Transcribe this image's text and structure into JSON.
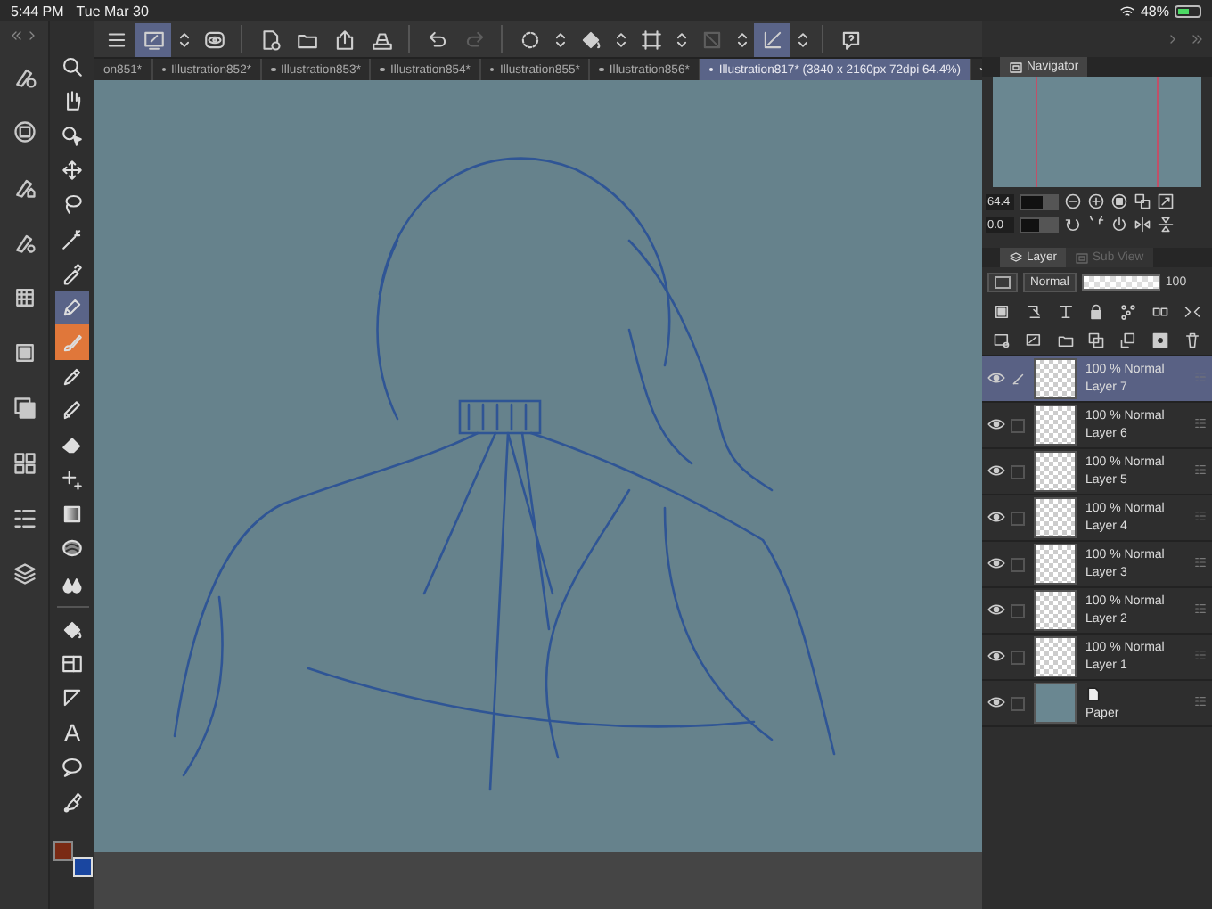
{
  "status_bar": {
    "time": "5:44 PM",
    "date": "Tue Mar 30",
    "battery": "48%"
  },
  "toolbar": {
    "items": [
      {
        "kind": "menu",
        "selected": false,
        "disabled": false
      },
      {
        "kind": "monitor",
        "selected": true,
        "disabled": false
      },
      {
        "kind": "stepper",
        "selected": false,
        "disabled": false
      },
      {
        "kind": "eye-badge",
        "selected": false,
        "disabled": false,
        "group_end": true
      },
      {
        "kind": "new-page",
        "selected": false,
        "disabled": false
      },
      {
        "kind": "folder",
        "selected": false,
        "disabled": false
      },
      {
        "kind": "share",
        "selected": false,
        "disabled": false
      },
      {
        "kind": "tray",
        "selected": false,
        "disabled": false,
        "group_end": true
      },
      {
        "kind": "undo",
        "selected": false,
        "disabled": false
      },
      {
        "kind": "redo",
        "selected": false,
        "disabled": true,
        "group_end": true
      },
      {
        "kind": "dotted-circle",
        "selected": false,
        "disabled": false
      },
      {
        "kind": "stepper",
        "selected": false,
        "disabled": false
      },
      {
        "kind": "fill-bucket",
        "selected": false,
        "disabled": false
      },
      {
        "kind": "stepper",
        "selected": false,
        "disabled": false
      },
      {
        "kind": "selection-frame",
        "selected": false,
        "disabled": false
      },
      {
        "kind": "stepper",
        "selected": false,
        "disabled": false
      },
      {
        "kind": "slash-square",
        "selected": false,
        "disabled": true
      },
      {
        "kind": "stepper",
        "selected": false,
        "disabled": false
      },
      {
        "kind": "ruler-check",
        "selected": true,
        "disabled": false
      },
      {
        "kind": "stepper",
        "selected": false,
        "disabled": false,
        "group_end": true
      },
      {
        "kind": "help",
        "selected": false,
        "disabled": false
      }
    ]
  },
  "tabs": [
    {
      "label": "on851*",
      "selected": false
    },
    {
      "label": "Illustration852*",
      "selected": false
    },
    {
      "label": "Illustration853*",
      "selected": false
    },
    {
      "label": "Illustration854*",
      "selected": false
    },
    {
      "label": "Illustration855*",
      "selected": false
    },
    {
      "label": "Illustration856*",
      "selected": false
    },
    {
      "label": "Illustration817* (3840 x 2160px 72dpi 64.4%)",
      "selected": true
    }
  ],
  "command_bar": {
    "items": [
      {
        "kind": "pen-circle"
      },
      {
        "kind": "circle-square"
      },
      {
        "kind": "pen-house"
      },
      {
        "kind": "pen-gear"
      },
      {
        "kind": "grid"
      },
      {
        "kind": "square"
      },
      {
        "kind": "stacked-square"
      },
      {
        "kind": "four-squares"
      },
      {
        "kind": "list"
      },
      {
        "kind": "stack"
      }
    ]
  },
  "tools": {
    "items": [
      {
        "kind": "search",
        "selected": false
      },
      {
        "kind": "hand",
        "selected": false
      },
      {
        "kind": "cursor",
        "selected": false
      },
      {
        "kind": "move",
        "selected": false
      },
      {
        "kind": "lasso",
        "selected": false
      },
      {
        "kind": "wand",
        "selected": false
      },
      {
        "kind": "eyedropper",
        "selected": false
      },
      {
        "kind": "pen",
        "selected": true
      },
      {
        "kind": "brush",
        "selected": false,
        "color": "#e0773a"
      },
      {
        "kind": "pencil",
        "selected": false
      },
      {
        "kind": "marker",
        "selected": false
      },
      {
        "kind": "eraser",
        "selected": false
      },
      {
        "kind": "sparkle",
        "selected": false
      },
      {
        "kind": "gradient",
        "selected": false
      },
      {
        "kind": "blob",
        "selected": false
      },
      {
        "kind": "drops",
        "selected": false
      },
      {
        "kind": "fill-bucket",
        "selected": false
      },
      {
        "kind": "frame",
        "selected": false
      },
      {
        "kind": "triangle",
        "selected": false
      },
      {
        "kind": "text",
        "selected": false,
        "glyph": "A"
      },
      {
        "kind": "speech-bubble",
        "selected": false
      },
      {
        "kind": "correction",
        "selected": false
      }
    ],
    "swatches": [
      {
        "kind": "main",
        "color": "#7a2a14"
      },
      {
        "kind": "sub",
        "color": "#1a46a0"
      }
    ]
  },
  "navigator": {
    "title": "Navigator",
    "zoom": "64.4",
    "zoom_slider": {
      "level": 0.6
    },
    "angle": "0.0",
    "angle_slider": {
      "level": 0.5
    }
  },
  "layer_panel": {
    "tabs": [
      {
        "label": "Layer",
        "selected": true
      },
      {
        "label": "Sub View",
        "selected": false
      }
    ],
    "blend_mode": "Normal",
    "opacity": "100",
    "opacity_slider": {
      "level": 1
    },
    "layers": [
      {
        "kind": "raster",
        "mode": "100 % Normal",
        "name": "Layer 7",
        "visible": true,
        "selected": true,
        "editing": true
      },
      {
        "kind": "raster",
        "mode": "100 % Normal",
        "name": "Layer 6",
        "visible": true,
        "selected": false,
        "editing": false
      },
      {
        "kind": "raster",
        "mode": "100 % Normal",
        "name": "Layer 5",
        "visible": true,
        "selected": false,
        "editing": false
      },
      {
        "kind": "raster",
        "mode": "100 % Normal",
        "name": "Layer 4",
        "visible": true,
        "selected": false,
        "editing": false
      },
      {
        "kind": "raster",
        "mode": "100 % Normal",
        "name": "Layer 3",
        "visible": true,
        "selected": false,
        "editing": false
      },
      {
        "kind": "raster",
        "mode": "100 % Normal",
        "name": "Layer 2",
        "visible": true,
        "selected": false,
        "editing": false
      },
      {
        "kind": "raster",
        "mode": "100 % Normal",
        "name": "Layer 1",
        "visible": true,
        "selected": false,
        "editing": false
      },
      {
        "kind": "paper",
        "name": "Paper",
        "visible": true,
        "selected": false,
        "editing": false
      }
    ]
  }
}
